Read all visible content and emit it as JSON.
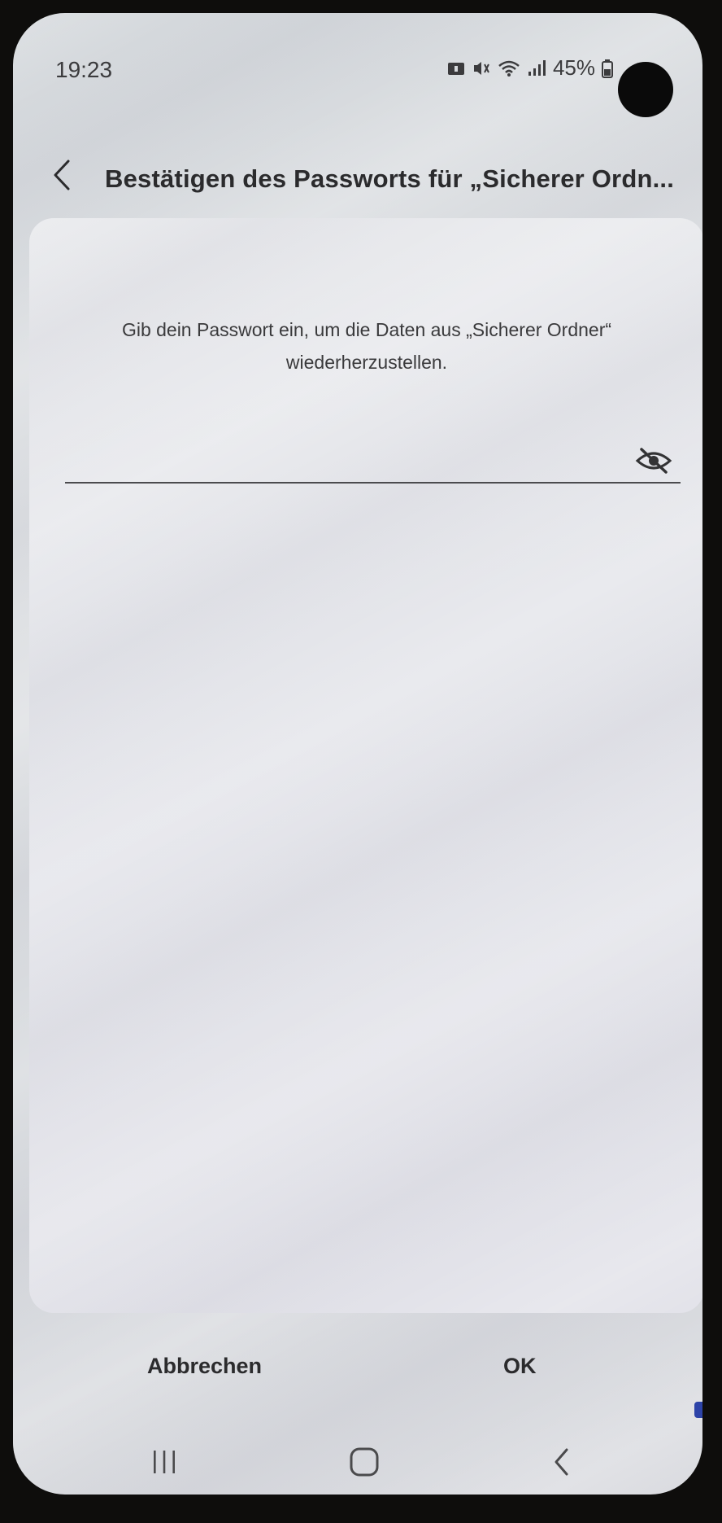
{
  "status_bar": {
    "time": "19:23",
    "battery": "45%",
    "icons": [
      "notification-icon",
      "mute-vibrate-icon",
      "wifi-icon",
      "signal-icon",
      "battery-icon"
    ]
  },
  "header": {
    "title": "Bestätigen des Passworts für „Sicherer Ordn...",
    "back_icon": "chevron-left-icon"
  },
  "dialog": {
    "prompt": "Gib dein Passwort ein, um die Daten aus „Sicherer Ordner“ wiederherzustellen.",
    "password_field": {
      "value": "",
      "placeholder": "",
      "toggle_icon": "eye-off-icon"
    }
  },
  "buttons": {
    "cancel_label": "Abbrechen",
    "ok_label": "OK"
  },
  "nav_bar": {
    "items": [
      "recents-icon",
      "home-icon",
      "back-icon"
    ]
  },
  "colors": {
    "text_primary": "#2b2b2d",
    "background": "#dcdee2",
    "card": "#e6e7eb",
    "underline": "#4b4b4e"
  }
}
